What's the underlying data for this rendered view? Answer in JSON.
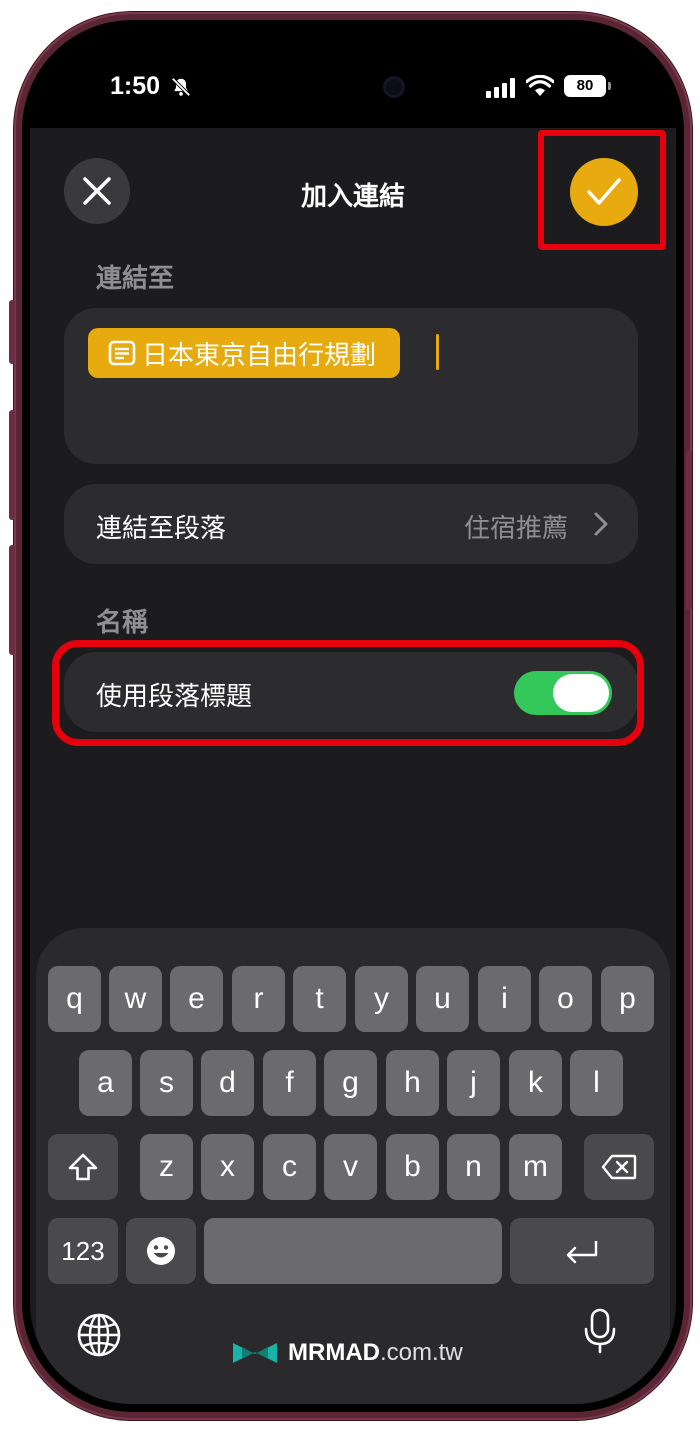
{
  "status_bar": {
    "time": "1:50",
    "battery": "80",
    "icons": [
      "bell-slash-icon",
      "signal-icon",
      "wifi-icon",
      "battery-icon"
    ]
  },
  "header": {
    "title": "加入連結",
    "close_icon": "close-icon",
    "confirm_icon": "checkmark-icon",
    "accent_color": "#e8ab0f"
  },
  "link_to": {
    "section_label": "連結至",
    "chip_text": "日本東京自由行規劃",
    "chip_icon": "note-icon"
  },
  "paragraph_row": {
    "label": "連結至段落",
    "value": "住宿推薦"
  },
  "name_section": {
    "section_label": "名稱",
    "toggle_label": "使用段落標題",
    "toggle_on": true,
    "toggle_color": "#34c759"
  },
  "keyboard": {
    "row1": [
      "q",
      "w",
      "e",
      "r",
      "t",
      "y",
      "u",
      "i",
      "o",
      "p"
    ],
    "row2": [
      "a",
      "s",
      "d",
      "f",
      "g",
      "h",
      "j",
      "k",
      "l"
    ],
    "row3": [
      "z",
      "x",
      "c",
      "v",
      "b",
      "n",
      "m"
    ],
    "numbers_key": "123",
    "icons": [
      "shift-icon",
      "backspace-icon",
      "emoji-icon",
      "return-icon",
      "globe-icon",
      "microphone-icon"
    ]
  },
  "watermark": {
    "brand": "MRMAD",
    "domain": ".com.tw"
  },
  "annotation_color": "#e6000e"
}
